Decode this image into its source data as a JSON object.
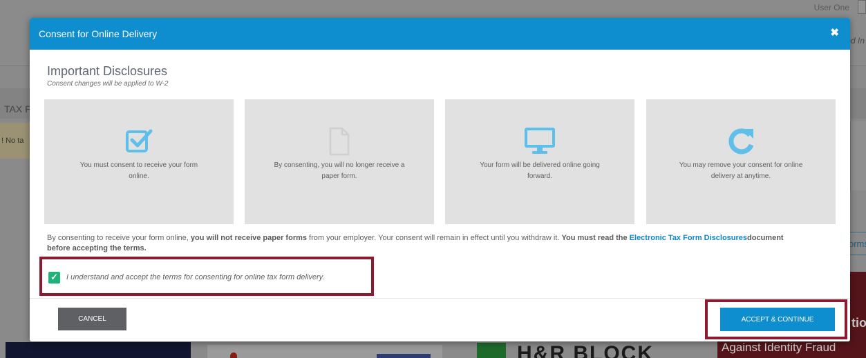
{
  "background": {
    "user_label": "User One",
    "edit_hint": "ed In",
    "tax_label": "TAX F",
    "warning_text": "! No ta",
    "forms_button_text": "orms",
    "ad_tion": "tion",
    "ad_fraud_text": "Against Identity Fraud",
    "ad_hrb_text": "H&R BLOCK"
  },
  "modal": {
    "title": "Consent for Online Delivery",
    "close_icon": "close-icon",
    "heading": "Important Disclosures",
    "subheading": "Consent changes will be applied to W-2",
    "cards": [
      {
        "icon": "checkbox-icon",
        "text": "You must consent to receive your form online."
      },
      {
        "icon": "document-icon",
        "text": "By consenting, you will no longer receive a paper form."
      },
      {
        "icon": "monitor-icon",
        "text": "Your form will be delivered online going forward."
      },
      {
        "icon": "refresh-icon",
        "text": "You may remove your consent for online delivery at anytime."
      }
    ],
    "terms": {
      "part1": "By consenting to receive your form online, ",
      "bold1": "you will not receive paper forms",
      "part2": " from your employer. Your consent will remain in effect until you withdraw it. ",
      "bold2": "You must read the ",
      "link": "Electronic Tax Form Disclosures",
      "bold3": "document before accepting the terms."
    },
    "consent_checked": true,
    "consent_label": "I understand and accept the terms for consenting for online tax form delivery.",
    "cancel_label": "CANCEL",
    "accept_label": "ACCEPT & CONTINUE"
  },
  "colors": {
    "header_blue": "#0e8dcf",
    "icon_blue": "#5ec0ea",
    "check_green": "#21b27a",
    "highlight_red": "#8c1b31",
    "cancel_gray": "#5f6063"
  }
}
